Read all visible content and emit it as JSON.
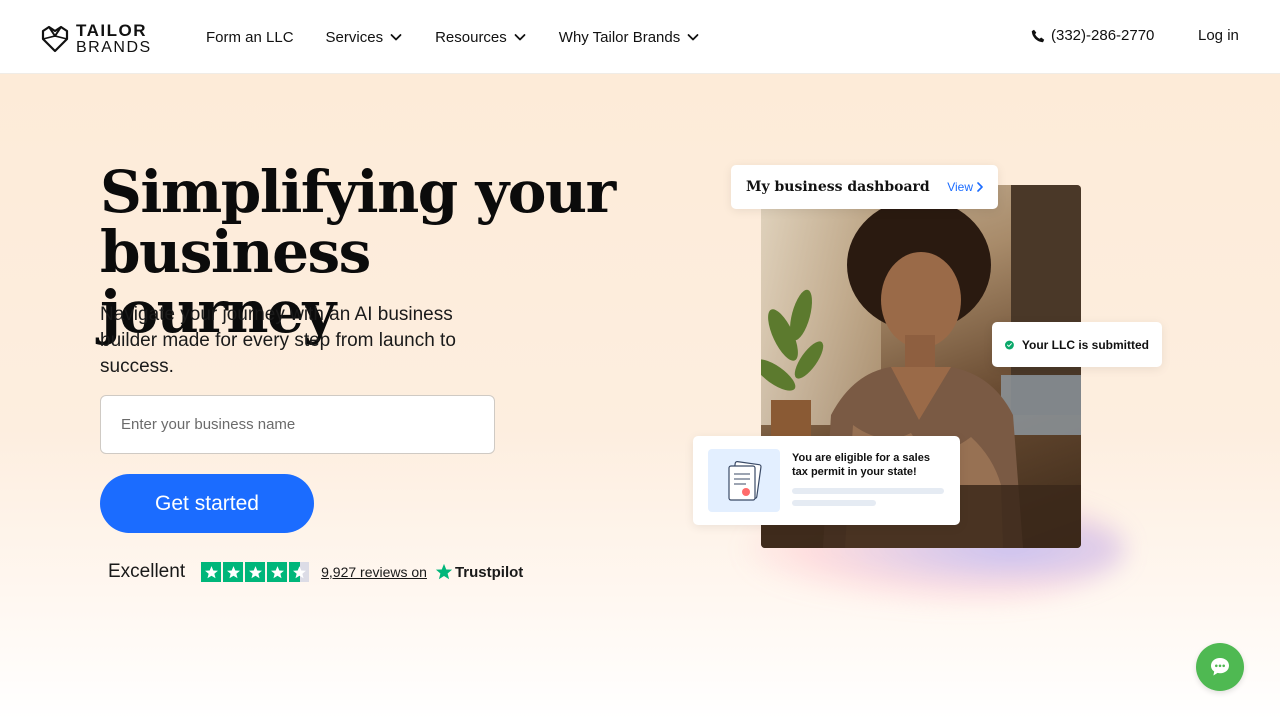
{
  "header": {
    "logo_line1": "TAILOR",
    "logo_line2": "BRANDS",
    "nav": [
      {
        "label": "Form an LLC",
        "has_dropdown": false
      },
      {
        "label": "Services",
        "has_dropdown": true
      },
      {
        "label": "Resources",
        "has_dropdown": true
      },
      {
        "label": "Why Tailor Brands",
        "has_dropdown": true
      }
    ],
    "phone": "(332)-286-2770",
    "login": "Log in"
  },
  "hero": {
    "headline": "Simplifying your business journey",
    "subheadline": "Navigate your journey with an AI business builder made for every step from launch to success.",
    "input_placeholder": "Enter your business name",
    "input_value": "",
    "cta_label": "Get started",
    "trustpilot": {
      "rating_word": "Excellent",
      "stars": 4.5,
      "reviews_text": "9,927 reviews on",
      "brand": "Trustpilot"
    }
  },
  "illustration": {
    "dashboard_title": "My business dashboard",
    "dashboard_link": "View",
    "llc_status": "Your LLC is submitted",
    "tax_message": "You are eligible for a sales tax permit in your state!"
  },
  "colors": {
    "primary": "#1b6cff",
    "hero_bg": "#fdebd8",
    "trustpilot_green": "#00b67a",
    "chat_green": "#4fb952"
  },
  "icons": [
    "logo-mark-icon",
    "chevron-down-icon",
    "phone-icon",
    "star-icon",
    "check-circle-icon",
    "document-icon",
    "chat-icon"
  ]
}
